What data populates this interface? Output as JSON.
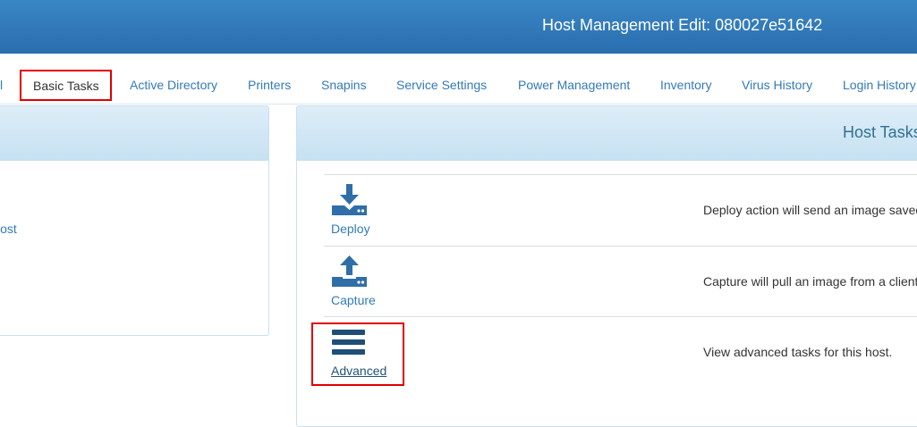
{
  "header": {
    "title": "Host Management Edit: 080027e51642"
  },
  "tabs": {
    "partial_left": "l",
    "items": [
      {
        "label": "Basic Tasks",
        "active": true
      },
      {
        "label": "Active Directory"
      },
      {
        "label": "Printers"
      },
      {
        "label": "Snapins"
      },
      {
        "label": "Service Settings"
      },
      {
        "label": "Power Management"
      },
      {
        "label": "Inventory"
      },
      {
        "label": "Virus History"
      },
      {
        "label": "Login History"
      }
    ]
  },
  "left_panel": {
    "link_text": "Host"
  },
  "host_tasks": {
    "title": "Host Tasks",
    "tasks": [
      {
        "label": "Deploy",
        "icon": "deploy-icon",
        "description": "Deploy action will send an image saved"
      },
      {
        "label": "Capture",
        "icon": "capture-icon",
        "description": "Capture will pull an image from a client"
      },
      {
        "label": "Advanced",
        "icon": "menu-bars-icon",
        "description": "View advanced tasks for this host."
      }
    ]
  },
  "colors": {
    "header": "#2a6eae",
    "link": "#337ab7",
    "highlight": "#e00000",
    "icon": "#2f6ea8"
  }
}
